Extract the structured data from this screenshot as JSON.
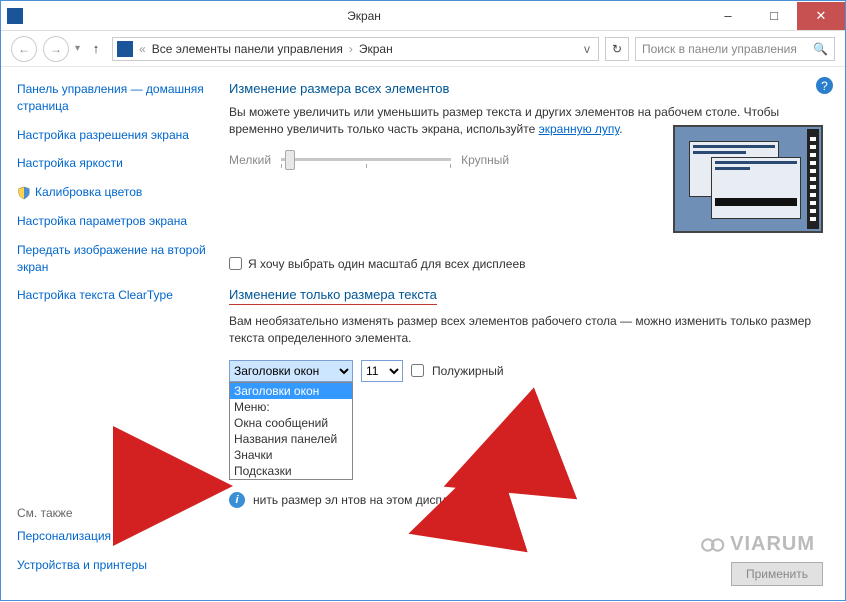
{
  "window": {
    "title": "Экран",
    "minimize": "–",
    "maximize": "□",
    "close": "✕"
  },
  "nav": {
    "crumb1": "Все элементы панели управления",
    "crumb2": "Экран",
    "search_placeholder": "Поиск в панели управления"
  },
  "sidebar": {
    "links": [
      "Панель управления — домашняя страница",
      "Настройка разрешения экрана",
      "Настройка яркости",
      "Калибровка цветов",
      "Настройка параметров экрана",
      "Передать изображение на второй экран",
      "Настройка текста ClearType"
    ],
    "see_also_head": "См. также",
    "see_also": [
      "Персонализация",
      "Устройства и принтеры"
    ]
  },
  "main": {
    "heading1": "Изменение размера всех элементов",
    "desc1_a": "Вы можете увеличить или уменьшить размер текста и других элементов на рабочем столе. Чтобы временно увеличить только часть экрана, используйте ",
    "desc1_link": "экранную лупу",
    "desc1_b": ".",
    "slider_small": "Мелкий",
    "slider_large": "Крупный",
    "checkbox1": "Я хочу выбрать один масштаб для всех дисплеев",
    "heading2": "Изменение только размера текста",
    "desc2": "Вам необязательно изменять размер всех элементов рабочего стола — можно изменить только размер текста определенного элемента.",
    "elem_selected": "Заголовки окон",
    "size_selected": "11",
    "bold_label": "Полужирный",
    "dropdown_options": [
      "Заголовки окон",
      "Меню:",
      "Окна сообщений",
      "Названия панелей",
      "Значки",
      "Подсказки"
    ],
    "note": "нить размер эл           нтов на этом дисплее.",
    "apply": "Применить"
  },
  "watermark": "VIARUM"
}
